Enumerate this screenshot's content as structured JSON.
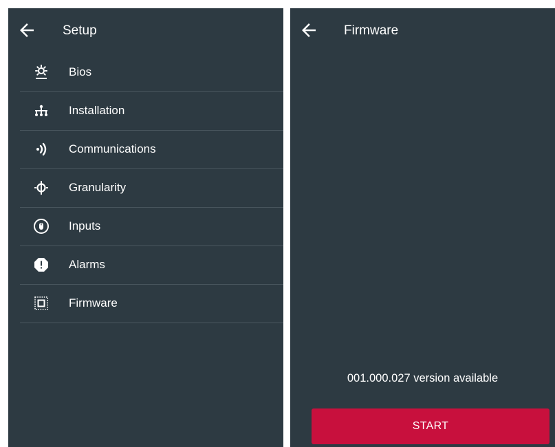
{
  "setup": {
    "title": "Setup",
    "back_icon": "arrow-left-icon",
    "items": [
      {
        "label": "Bios",
        "icon": "brightness-icon"
      },
      {
        "label": "Installation",
        "icon": "network-tree-icon"
      },
      {
        "label": "Communications",
        "icon": "signal-waves-icon"
      },
      {
        "label": "Granularity",
        "icon": "phi-target-icon"
      },
      {
        "label": "Inputs",
        "icon": "mouse-circle-icon"
      },
      {
        "label": "Alarms",
        "icon": "alert-octagon-icon"
      },
      {
        "label": "Firmware",
        "icon": "chip-icon"
      }
    ]
  },
  "firmware": {
    "title": "Firmware",
    "back_icon": "arrow-left-icon",
    "version_text": "001.000.027 version available",
    "start_label": "START"
  },
  "colors": {
    "background": "#2d3a42",
    "divider": "#4a575f",
    "accent": "#c8103d",
    "text": "#ffffff"
  }
}
